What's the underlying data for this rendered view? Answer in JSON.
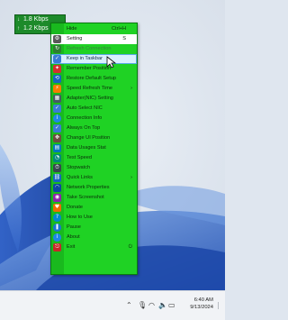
{
  "speed_widget": {
    "download_text": "1.8 Kbps",
    "upload_text": "1.2 Kbps",
    "colors": {
      "background": "#1d8a2a",
      "text": "#ffffff"
    }
  },
  "menu": {
    "colors": {
      "background": "#1fd224",
      "gutter": "#19b91e",
      "highlight": "#ffffff",
      "selected": "#d9f0ff"
    },
    "items": [
      {
        "label": "Hide",
        "shortcut": "Ctrl+H",
        "icon": "none",
        "state": "normal"
      },
      {
        "label": "Setting",
        "shortcut": "S",
        "icon": "settings-icon",
        "state": "highlighted"
      },
      {
        "label": "Refresh Connection",
        "icon": "refresh-icon",
        "state": "dim"
      },
      {
        "label": "Keep in Taskbar",
        "icon": "checkmark-icon",
        "state": "selected"
      },
      {
        "label": "Remember Position",
        "icon": "pin-icon",
        "state": "normal"
      },
      {
        "label": "Restore Default Setup",
        "icon": "restore-icon",
        "state": "normal"
      },
      {
        "label": "Speed Refresh Time",
        "icon": "speed-icon",
        "state": "normal",
        "submenu": true
      },
      {
        "label": "Adapter(NIC) Setting",
        "icon": "network-adapter-icon",
        "state": "normal"
      },
      {
        "label": "Auto Select NIC",
        "icon": "checkmark-icon",
        "state": "normal"
      },
      {
        "label": "Connection Info",
        "icon": "info-icon",
        "state": "normal"
      },
      {
        "label": "Always On Top",
        "icon": "checkmark-icon",
        "state": "normal"
      },
      {
        "label": "Change UI Position",
        "icon": "position-icon",
        "state": "normal"
      },
      {
        "label": "Data Usages Stat",
        "icon": "stats-icon",
        "state": "normal"
      },
      {
        "label": "Test Speed",
        "icon": "speedometer-icon",
        "state": "normal"
      },
      {
        "label": "Stopwatch",
        "icon": "stopwatch-icon",
        "state": "normal"
      },
      {
        "label": "Quick Links",
        "icon": "link-icon",
        "state": "normal",
        "submenu": true
      },
      {
        "label": "Network Properties",
        "icon": "wifi-icon",
        "state": "normal"
      },
      {
        "label": "Take Screenshot",
        "icon": "camera-icon",
        "state": "normal"
      },
      {
        "label": "Donate",
        "icon": "donate-icon",
        "state": "normal"
      },
      {
        "label": "How to Use",
        "icon": "help-icon",
        "state": "normal"
      },
      {
        "label": "Pause",
        "icon": "pause-icon",
        "state": "normal"
      },
      {
        "label": "About",
        "icon": "about-icon",
        "state": "normal"
      },
      {
        "label": "Exit",
        "icon": "exit-icon",
        "state": "normal",
        "trailing_icon": "power-icon"
      }
    ],
    "submenu_arrow": "›"
  },
  "taskbar": {
    "tray_icons": [
      "chevron-up-icon",
      "microphone-icon",
      "wifi-icon",
      "speaker-icon",
      "battery-icon"
    ],
    "time": "6:40 AM",
    "date": "9/13/2024"
  }
}
